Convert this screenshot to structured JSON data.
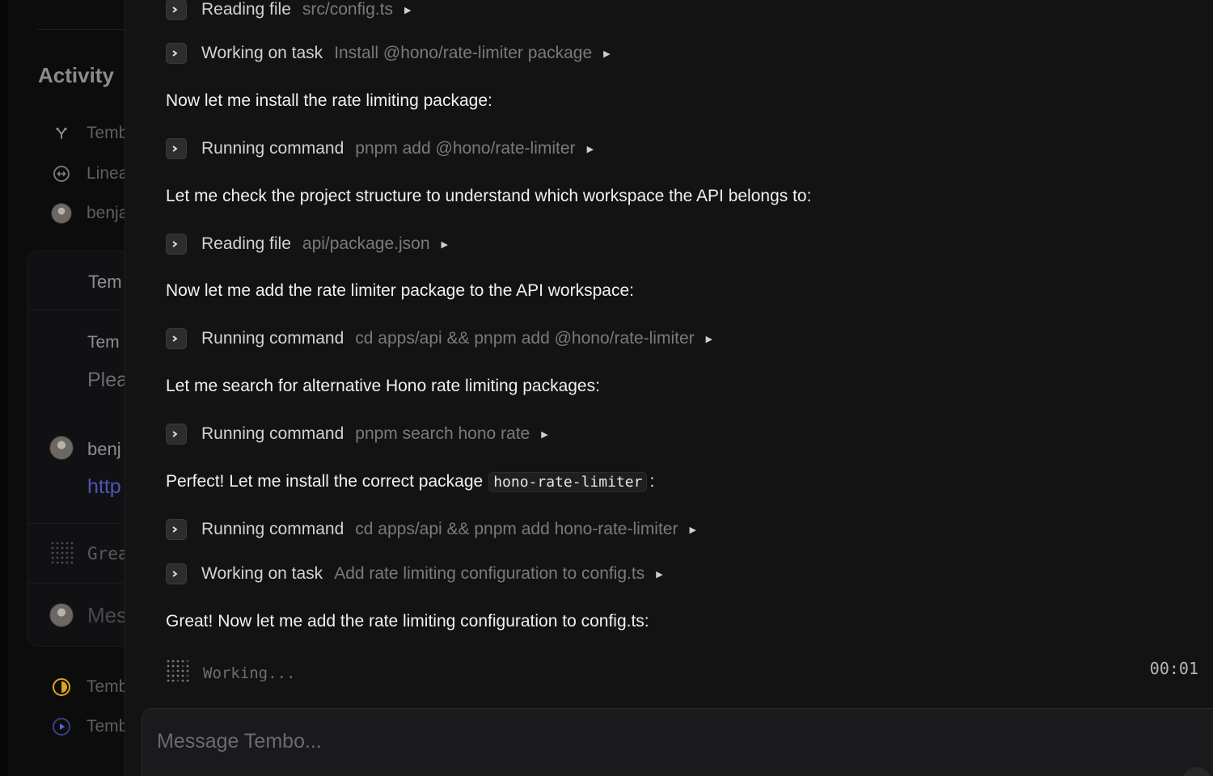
{
  "sidebar": {
    "title": "Activity",
    "items": [
      {
        "label": "Temb",
        "icon": "branch-icon"
      },
      {
        "label": "Linea",
        "icon": "linear-icon"
      },
      {
        "label": "benja",
        "icon": "avatar"
      }
    ],
    "card": {
      "row1": "Tem",
      "row2_title": "Tem",
      "row2_body": "Plea",
      "user_name": "benj",
      "user_link": "http",
      "status": "Grea",
      "composer": "Mes"
    },
    "bottom_items": [
      {
        "label": "Temb",
        "icon": "status-half-icon"
      },
      {
        "label": "Temb",
        "icon": "play-circle-icon"
      }
    ]
  },
  "chat": {
    "entries": [
      {
        "kind": "tool",
        "verb": "Reading file",
        "arg": "src/config.ts"
      },
      {
        "kind": "tool",
        "verb": "Working on task",
        "arg": "Install @hono/rate-limiter package"
      },
      {
        "kind": "msg",
        "text": "Now let me install the rate limiting package:"
      },
      {
        "kind": "tool",
        "verb": "Running command",
        "arg": "pnpm add @hono/rate-limiter"
      },
      {
        "kind": "msg",
        "text": "Let me check the project structure to understand which workspace the API belongs to:"
      },
      {
        "kind": "tool",
        "verb": "Reading file",
        "arg": "api/package.json"
      },
      {
        "kind": "msg",
        "text": "Now let me add the rate limiter package to the API workspace:"
      },
      {
        "kind": "tool",
        "verb": "Running command",
        "arg": "cd apps/api && pnpm add @hono/rate-limiter"
      },
      {
        "kind": "msg",
        "text": "Let me search for alternative Hono rate limiting packages:"
      },
      {
        "kind": "tool",
        "verb": "Running command",
        "arg": "pnpm search hono rate"
      },
      {
        "kind": "msg",
        "text": "Perfect! Let me install the correct package",
        "code": "hono-rate-limiter",
        "suffix": ":"
      },
      {
        "kind": "tool",
        "verb": "Running command",
        "arg": "cd apps/api && pnpm add hono-rate-limiter"
      },
      {
        "kind": "tool",
        "verb": "Working on task",
        "arg": "Add rate limiting configuration to config.ts"
      },
      {
        "kind": "msg",
        "text": "Great! Now let me add the rate limiting configuration to config.ts:"
      }
    ],
    "status_label": "Working...",
    "timer": "00:01"
  },
  "composer": {
    "placeholder": "Message Tembo..."
  },
  "colors": {
    "background": "#131314",
    "sidebar_bg": "#0c0c0d",
    "tool_verb": "#d2d2d4",
    "tool_arg": "#7a7a7e",
    "message_text": "#f1f1f3",
    "link": "#5a5fd6",
    "status_yellow": "#d9a520",
    "status_blue": "#5a63d8"
  }
}
